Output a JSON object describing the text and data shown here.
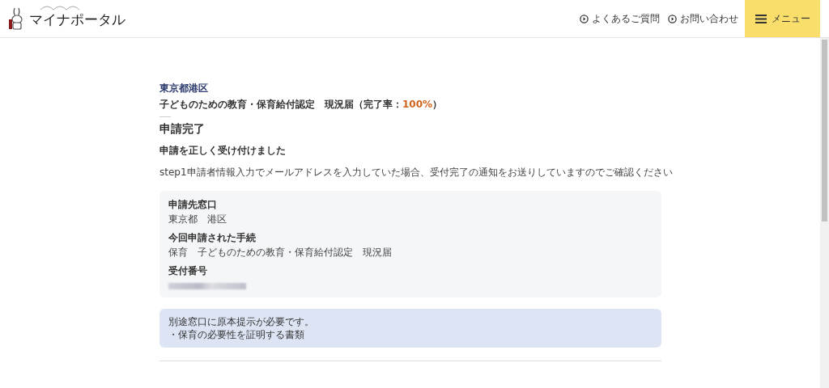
{
  "header": {
    "logo_text": "マイナポータル",
    "links": [
      {
        "label": "よくあるご質問"
      },
      {
        "label": "お問い合わせ"
      }
    ],
    "menu_label": "メニュー"
  },
  "context": {
    "municipality": "東京都港区",
    "procedure_prefix": "子どものための教育・保育給付認定　現況届（完了率：",
    "completion_rate": "100%",
    "procedure_suffix": "）"
  },
  "heading": "申請完了",
  "subheading": "申請を正しく受け付けました",
  "message": "step1申請者情報入力でメールアドレスを入力していた場合、受付完了の通知をお送りしていますのでご確認ください",
  "details": [
    {
      "label": "申請先窓口",
      "value": "東京都　港区",
      "kind": "text"
    },
    {
      "label": "今回申請された手続",
      "value": "保育　子どものための教育・保育給付認定　現況届",
      "kind": "text"
    },
    {
      "label": "受付番号",
      "kind": "redacted"
    }
  ],
  "notice": [
    "別途窓口に原本提示が必要です。",
    "・保育の必要性を証明する書類"
  ]
}
